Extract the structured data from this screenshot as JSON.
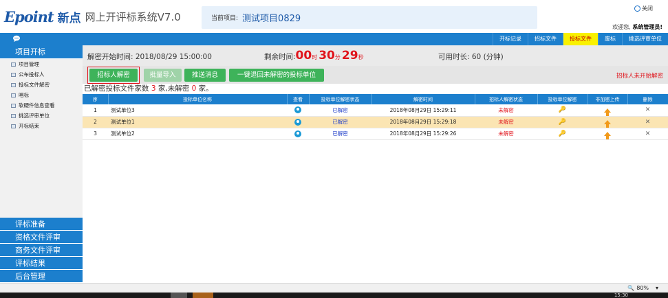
{
  "header": {
    "logo_mark": "Epoint",
    "logo_cn": "新点",
    "system_title": "网上开评标系统V7.0",
    "project_label": "当前项目:",
    "project_name": "测试项目0829",
    "close_label": "关闭",
    "welcome_prefix": "欢迎您,",
    "welcome_user": "系统管理员!"
  },
  "nav": {
    "items": [
      "开标记录",
      "招标文件",
      "投标文件",
      "废标",
      "挑选评审单位"
    ],
    "active_index": 2
  },
  "sidebar": {
    "top_title": "项目开标",
    "items": [
      "项目管理",
      "公布投标人",
      "投标文件解密",
      "唱标",
      "软硬件信息查看",
      "挑选评审单位",
      "开标结束"
    ],
    "bottom_sections": [
      "评标准备",
      "资格文件评审",
      "商务文件评审",
      "评标结果",
      "后台管理"
    ]
  },
  "info": {
    "start_time": "解密开始时间: 2018/08/29 15:00:00",
    "remain_label": "剩余时间:",
    "remain_h": "00",
    "remain_h_unit": "时",
    "remain_m": "30",
    "remain_m_unit": "分",
    "remain_s": "29",
    "remain_s_unit": "秒",
    "available": "可用时长: 60 (分钟)"
  },
  "toolbar": {
    "btn_decrypt": "招标人解密",
    "btn_import": "批量导入",
    "btn_push": "推送消息",
    "btn_return": "一键退回未解密的投标单位",
    "status_right": "招标人未开始解密"
  },
  "summary": {
    "prefix": "已解密投标文件家数",
    "decrypted": "3",
    "mid": "家,未解密",
    "undecrypted": "0",
    "suffix": "家。"
  },
  "table": {
    "headers": [
      "序",
      "投标单位名称",
      "查看",
      "投标单位解密状态",
      "解密时间",
      "招标人解密状态",
      "投标单位解密",
      "非加密上传",
      "删除"
    ],
    "rows": [
      {
        "no": "1",
        "name": "测试单位3",
        "status": "已解密",
        "time": "2018年08月29日 15:29:11",
        "tstatus": "未解密"
      },
      {
        "no": "2",
        "name": "测试单位1",
        "status": "已解密",
        "time": "2018年08月29日 15:29:18",
        "tstatus": "未解密"
      },
      {
        "no": "3",
        "name": "测试单位2",
        "status": "已解密",
        "time": "2018年08月29日 15:29:26",
        "tstatus": "未解密"
      }
    ],
    "selected_row": 1
  },
  "footer": {
    "zoom": "80%",
    "clock": "15:30"
  }
}
